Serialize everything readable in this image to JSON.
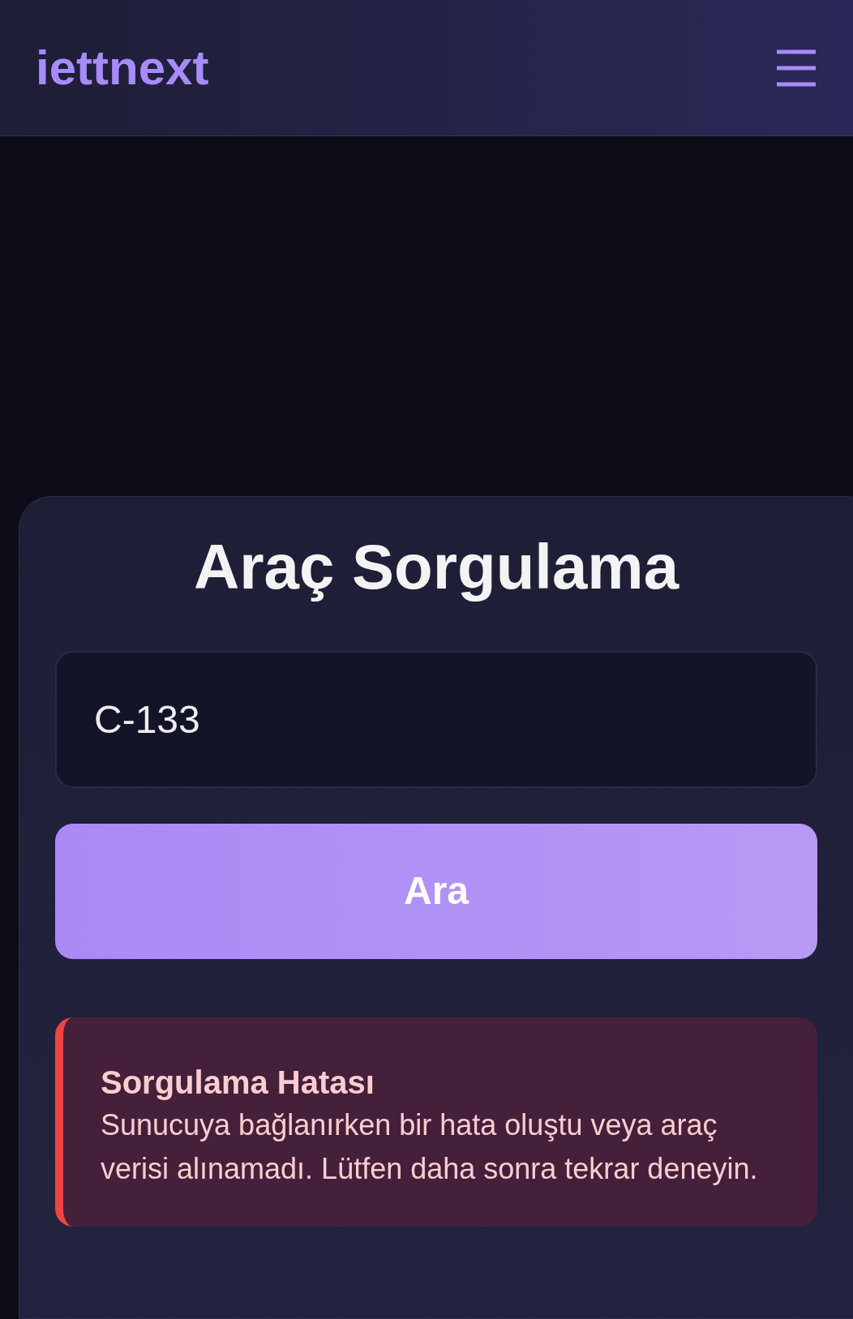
{
  "header": {
    "logo": "iettnext"
  },
  "search_card": {
    "title": "Araç Sorgulama",
    "input": {
      "value": "C-133"
    },
    "button": "Ara"
  },
  "error": {
    "title": "Sorgulama Hatası",
    "message": "Sunucuya bağlanırken bir hata oluştu veya araç verisi alınamadı. Lütfen daha sonra tekrar deneyin."
  }
}
